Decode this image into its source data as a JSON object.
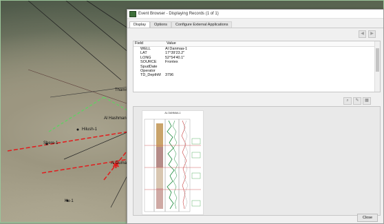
{
  "map": {
    "labels": [
      {
        "id": "thamra",
        "text": "Thamra"
      },
      {
        "id": "al_hashman",
        "text": "Al Hashman-"
      },
      {
        "id": "hilush",
        "text": "Hilush-1"
      },
      {
        "id": "shere",
        "text": "Shere-1"
      },
      {
        "id": "al_dumaa",
        "text": "Al Dumaa"
      },
      {
        "id": "kulu",
        "text": "Ku-1"
      }
    ]
  },
  "window": {
    "title": "Event Browser - Displaying Records (1 of 1)",
    "tabs": [
      {
        "label": "Display",
        "active": true
      },
      {
        "label": "Options",
        "active": false
      },
      {
        "label": "Configure External Applications",
        "active": false
      }
    ],
    "nav": {
      "prev_icon": "◀",
      "next_icon": "▶"
    },
    "table": {
      "columns": {
        "field": "Field",
        "value": "Value"
      },
      "rows": [
        {
          "field": "WELL",
          "value": "Al Danmaa-1"
        },
        {
          "field": "LAT",
          "value": "17°39'23.2\""
        },
        {
          "field": "LONG",
          "value": "52°54'40.1\""
        },
        {
          "field": "SOURCE",
          "value": "Frontex"
        },
        {
          "field": "SpudDate",
          "value": ""
        },
        {
          "field": "Operator",
          "value": ""
        },
        {
          "field": "TD_DepthM",
          "value": "3796"
        }
      ]
    },
    "viewer": {
      "log_title": "AL DANMAA-1"
    },
    "close_label": "Close"
  }
}
